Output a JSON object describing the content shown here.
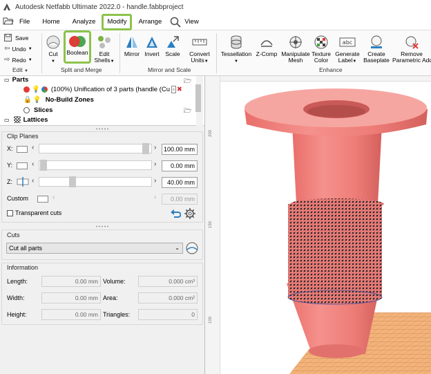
{
  "window": {
    "title": "Autodesk Netfabb Ultimate 2022.0 - handle.fabbproject"
  },
  "menu": {
    "file": "File",
    "home": "Home",
    "analyze": "Analyze",
    "modify": "Modify",
    "arrange": "Arrange",
    "view": "View"
  },
  "ribbon": {
    "edit": {
      "save": "Save",
      "undo": "Undo",
      "redo": "Redo",
      "group": "Edit"
    },
    "split_merge": {
      "cut": "Cut",
      "boolean": "Boolean",
      "edit_shells_1": "Edit",
      "edit_shells_2": "Shells",
      "group": "Split and Merge"
    },
    "mirror_scale": {
      "mirror": "Mirror",
      "invert": "Invert",
      "scale": "Scale",
      "convert_1": "Convert",
      "convert_2": "Units",
      "group": "Mirror and Scale"
    },
    "enhance": {
      "tessellation": "Tessellation",
      "zcomp": "Z-Comp",
      "manipulate_1": "Manipulate",
      "manipulate_2": "Mesh",
      "texture_1": "Texture",
      "texture_2": "Color",
      "label_1": "Generate",
      "label_2": "Label",
      "baseplate_1": "Create",
      "baseplate_2": "Baseplate",
      "remove_1": "Remove",
      "remove_2": "Parametric Add",
      "group": "Enhance"
    }
  },
  "tree": {
    "parts": "Parts",
    "item": "(100%) Unification of 3 parts (handle (Cu",
    "no_build": "No-Build Zones",
    "slices": "Slices",
    "lattices": "Lattices"
  },
  "clip_planes": {
    "title": "Clip Planes",
    "x_label": "X:",
    "x_value": "100.00 mm",
    "y_label": "Y:",
    "y_value": "0.00 mm",
    "z_label": "Z:",
    "z_value": "40.00 mm",
    "custom_label": "Custom",
    "custom_value": "0.00 mm",
    "transparent_cuts": "Transparent cuts"
  },
  "cuts": {
    "title": "Cuts",
    "selected": "Cut all parts"
  },
  "information": {
    "title": "Information",
    "length_label": "Length:",
    "length": "0.00 mm",
    "width_label": "Width:",
    "width": "0.00 mm",
    "height_label": "Height:",
    "height": "0.00 mm",
    "volume_label": "Volume:",
    "volume": "0.000 cm³",
    "area_label": "Area:",
    "area": "0.000 cm²",
    "triangles_label": "Triangles:",
    "triangles": "0"
  },
  "ruler": {
    "t200": "200",
    "t150": "150",
    "t100": "100"
  },
  "colors": {
    "highlight": "#8bc34a",
    "part": "#f07e7a",
    "plate": "#f3b37a"
  }
}
